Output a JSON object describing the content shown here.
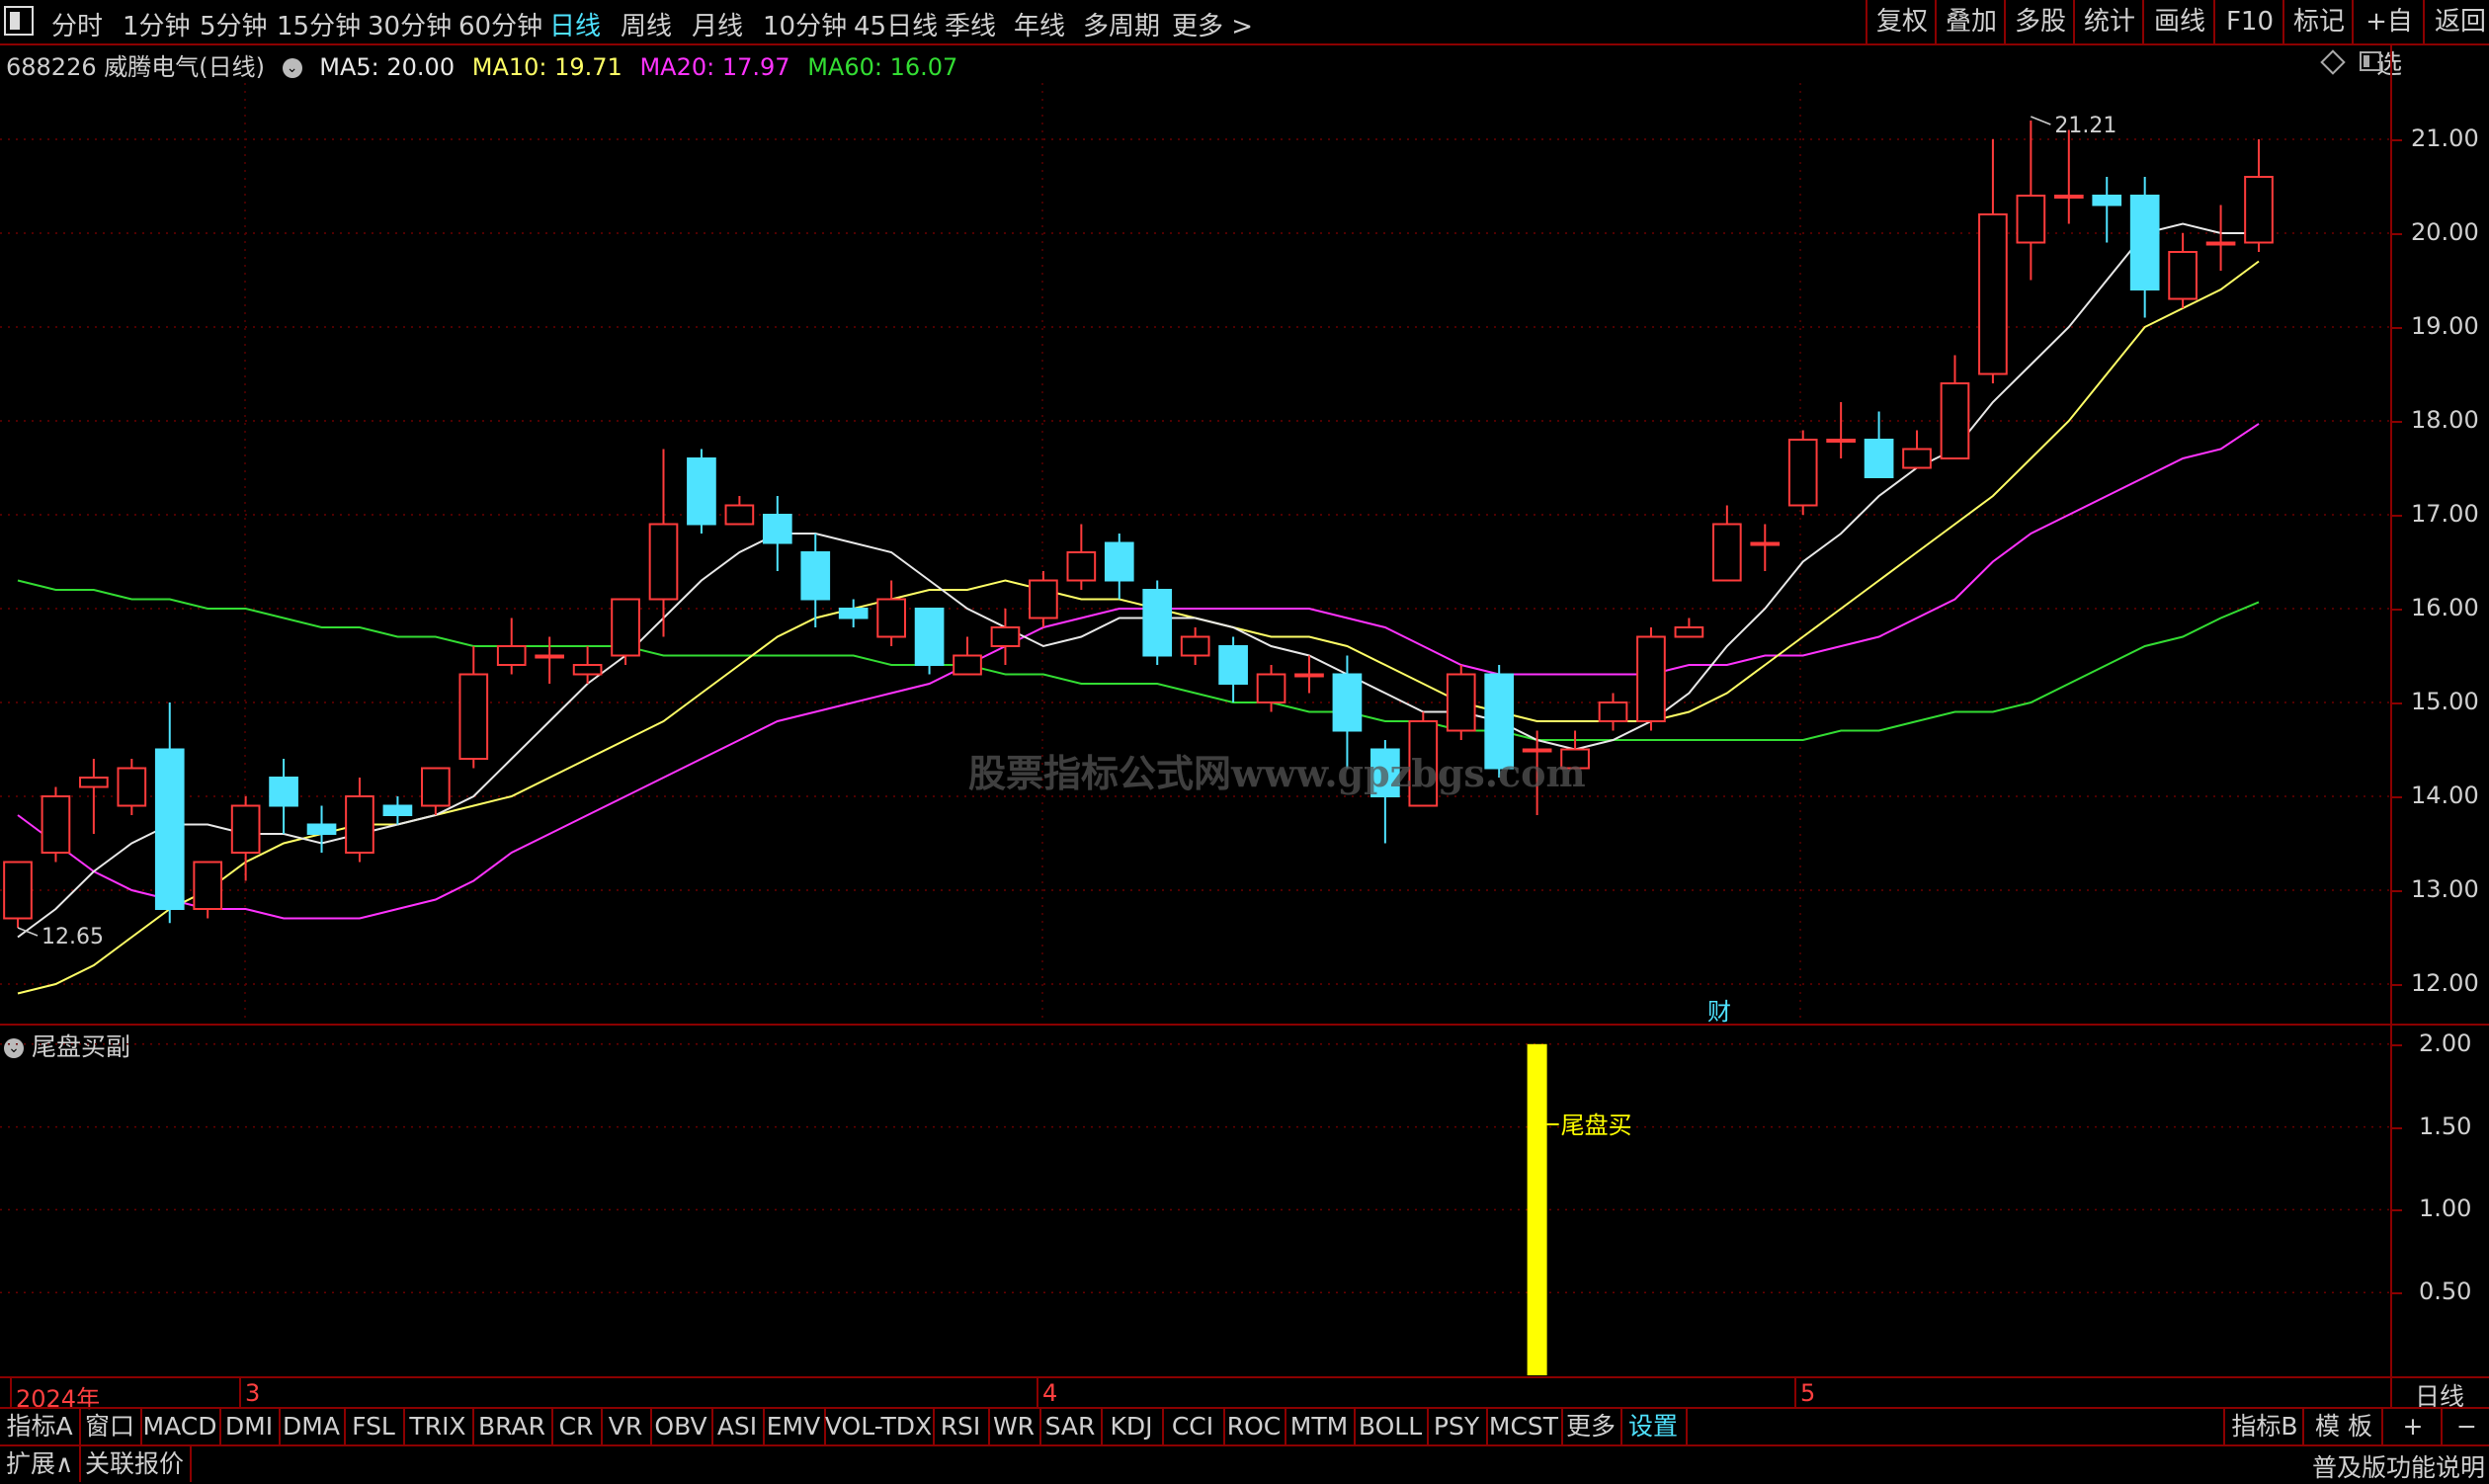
{
  "topbar": {
    "periods": [
      "分时",
      "1分钟",
      "5分钟",
      "15分钟",
      "30分钟",
      "60分钟",
      "日线",
      "周线",
      "月线",
      "10分钟",
      "45日线",
      "季线",
      "年线",
      "多周期",
      "更多 >"
    ],
    "active_period": "日线",
    "right_buttons": [
      "复权",
      "叠加",
      "多股",
      "统计",
      "画线",
      "F10",
      "标记",
      "+自选",
      "返回"
    ]
  },
  "info": {
    "stock": "688226 威腾电气(日线)",
    "ma5": "MA5: 20.00",
    "ma10": "MA10: 19.71",
    "ma20": "MA20: 17.97",
    "ma60": "MA60: 16.07"
  },
  "colors": {
    "up": "#ff3b3b",
    "down": "#4fe3ff",
    "ma5": "#e8e8e8",
    "ma10": "#ffff66",
    "ma20": "#ff33ff",
    "ma60": "#33dd33",
    "frame": "#8b0000",
    "signal": "#ffff00"
  },
  "main_axis": [
    "21.00",
    "20.00",
    "19.00",
    "18.00",
    "17.00",
    "16.00",
    "15.00",
    "14.00",
    "13.00",
    "12.00"
  ],
  "sub_axis": [
    "2.00",
    "1.50",
    "1.00",
    "0.50"
  ],
  "annotations": {
    "high": "21.21",
    "low": "12.65",
    "finance_marker": "财"
  },
  "watermark": "股票指标公式网www.gpzbgs.com",
  "sub_panel": {
    "title": "尾盘买副",
    "signal_label": "尾盘买"
  },
  "date_axis": {
    "labels": [
      "2024年",
      "3",
      "4",
      "5"
    ],
    "period_label": "日线"
  },
  "indicator_tabs": [
    "指标A",
    "窗口",
    "MACD",
    "DMI",
    "DMA",
    "FSL",
    "TRIX",
    "BRAR",
    "CR",
    "VR",
    "OBV",
    "ASI",
    "EMV",
    "VOL-TDX",
    "RSI",
    "WR",
    "SAR",
    "KDJ",
    "CCI",
    "ROC",
    "MTM",
    "BOLL",
    "PSY",
    "MCST",
    "更多",
    "设置"
  ],
  "indicator_right": [
    "指标B",
    "模 板",
    "+",
    "−"
  ],
  "bottom_tabs": [
    "扩展∧",
    "关联报价"
  ],
  "bottom_right": "普及版功能说明",
  "chart_data": {
    "type": "candlestick",
    "ylim": [
      11.6,
      21.6
    ],
    "candles": [
      [
        12.7,
        13.3,
        12.6,
        13.3
      ],
      [
        13.4,
        14.0,
        13.3,
        14.1
      ],
      [
        14.1,
        14.2,
        13.6,
        14.4
      ],
      [
        13.9,
        14.3,
        13.8,
        14.4
      ],
      [
        14.5,
        12.8,
        12.65,
        15.0
      ],
      [
        12.8,
        13.3,
        12.7,
        13.3
      ],
      [
        13.4,
        13.9,
        13.1,
        14.0
      ],
      [
        14.2,
        13.9,
        13.6,
        14.4
      ],
      [
        13.7,
        13.6,
        13.4,
        13.9
      ],
      [
        13.4,
        14.0,
        13.3,
        14.2
      ],
      [
        13.9,
        13.8,
        13.7,
        14.0
      ],
      [
        13.9,
        14.3,
        13.8,
        14.3
      ],
      [
        14.4,
        15.3,
        14.3,
        15.6
      ],
      [
        15.4,
        15.6,
        15.3,
        15.9
      ],
      [
        15.5,
        15.5,
        15.2,
        15.7
      ],
      [
        15.3,
        15.4,
        15.2,
        15.6
      ],
      [
        15.5,
        16.1,
        15.4,
        16.1
      ],
      [
        16.1,
        16.9,
        15.7,
        17.7
      ],
      [
        17.6,
        16.9,
        16.8,
        17.7
      ],
      [
        16.9,
        17.1,
        16.9,
        17.2
      ],
      [
        17.0,
        16.7,
        16.4,
        17.2
      ],
      [
        16.6,
        16.1,
        15.8,
        16.8
      ],
      [
        16.0,
        15.9,
        15.8,
        16.1
      ],
      [
        15.7,
        16.1,
        15.6,
        16.3
      ],
      [
        16.0,
        15.4,
        15.3,
        16.0
      ],
      [
        15.3,
        15.5,
        15.3,
        15.7
      ],
      [
        15.6,
        15.8,
        15.4,
        16.0
      ],
      [
        15.9,
        16.3,
        15.8,
        16.4
      ],
      [
        16.3,
        16.6,
        16.2,
        16.9
      ],
      [
        16.7,
        16.3,
        16.1,
        16.8
      ],
      [
        16.2,
        15.5,
        15.4,
        16.3
      ],
      [
        15.5,
        15.7,
        15.4,
        15.8
      ],
      [
        15.6,
        15.2,
        15.0,
        15.7
      ],
      [
        15.0,
        15.3,
        14.9,
        15.4
      ],
      [
        15.3,
        15.3,
        15.1,
        15.5
      ],
      [
        15.3,
        14.7,
        14.3,
        15.5
      ],
      [
        14.5,
        14.0,
        13.5,
        14.6
      ],
      [
        13.9,
        14.8,
        13.9,
        14.9
      ],
      [
        14.7,
        15.3,
        14.6,
        15.4
      ],
      [
        15.3,
        14.3,
        14.2,
        15.4
      ],
      [
        14.5,
        14.5,
        13.8,
        14.7
      ],
      [
        14.3,
        14.5,
        14.3,
        14.7
      ],
      [
        14.8,
        15.0,
        14.7,
        15.1
      ],
      [
        14.8,
        15.7,
        14.7,
        15.8
      ],
      [
        15.7,
        15.8,
        15.7,
        15.9
      ],
      [
        16.3,
        16.9,
        16.3,
        17.1
      ],
      [
        16.7,
        16.7,
        16.4,
        16.9
      ],
      [
        17.1,
        17.8,
        17.0,
        17.9
      ],
      [
        17.8,
        17.8,
        17.6,
        18.2
      ],
      [
        17.8,
        17.4,
        17.4,
        18.1
      ],
      [
        17.5,
        17.7,
        17.5,
        17.9
      ],
      [
        17.6,
        18.4,
        17.6,
        18.7
      ],
      [
        18.5,
        20.2,
        18.4,
        21.0
      ],
      [
        19.9,
        20.4,
        19.5,
        21.2
      ],
      [
        20.4,
        20.4,
        20.1,
        21.1
      ],
      [
        20.4,
        20.3,
        19.9,
        20.6
      ],
      [
        20.4,
        19.4,
        19.1,
        20.6
      ],
      [
        19.3,
        19.8,
        19.2,
        20.0
      ],
      [
        19.9,
        19.9,
        19.6,
        20.3
      ],
      [
        19.9,
        20.6,
        19.8,
        21.0
      ]
    ],
    "ma5": [
      12.5,
      12.8,
      13.2,
      13.5,
      13.7,
      13.7,
      13.6,
      13.6,
      13.5,
      13.6,
      13.7,
      13.8,
      14.0,
      14.4,
      14.8,
      15.2,
      15.5,
      15.9,
      16.3,
      16.6,
      16.8,
      16.8,
      16.7,
      16.6,
      16.3,
      16.0,
      15.8,
      15.6,
      15.7,
      15.9,
      15.9,
      15.9,
      15.8,
      15.6,
      15.5,
      15.3,
      15.1,
      14.9,
      14.9,
      14.8,
      14.6,
      14.5,
      14.6,
      14.8,
      15.1,
      15.6,
      16.0,
      16.5,
      16.8,
      17.2,
      17.5,
      17.7,
      18.2,
      18.6,
      19.0,
      19.5,
      20.0,
      20.1,
      20.0,
      20.0
    ],
    "ma10": [
      11.9,
      12.0,
      12.2,
      12.5,
      12.8,
      13.0,
      13.3,
      13.5,
      13.6,
      13.7,
      13.7,
      13.8,
      13.9,
      14.0,
      14.2,
      14.4,
      14.6,
      14.8,
      15.1,
      15.4,
      15.7,
      15.9,
      16.0,
      16.1,
      16.2,
      16.2,
      16.3,
      16.2,
      16.1,
      16.1,
      16.0,
      15.9,
      15.8,
      15.7,
      15.7,
      15.6,
      15.4,
      15.2,
      15.0,
      14.9,
      14.8,
      14.8,
      14.8,
      14.8,
      14.9,
      15.1,
      15.4,
      15.7,
      16.0,
      16.3,
      16.6,
      16.9,
      17.2,
      17.6,
      18.0,
      18.5,
      19.0,
      19.2,
      19.4,
      19.7
    ],
    "ma20": [
      13.8,
      13.5,
      13.2,
      13.0,
      12.9,
      12.8,
      12.8,
      12.7,
      12.7,
      12.7,
      12.8,
      12.9,
      13.1,
      13.4,
      13.6,
      13.8,
      14.0,
      14.2,
      14.4,
      14.6,
      14.8,
      14.9,
      15.0,
      15.1,
      15.2,
      15.4,
      15.6,
      15.8,
      15.9,
      16.0,
      16.0,
      16.0,
      16.0,
      16.0,
      16.0,
      15.9,
      15.8,
      15.6,
      15.4,
      15.3,
      15.3,
      15.3,
      15.3,
      15.3,
      15.4,
      15.4,
      15.5,
      15.5,
      15.6,
      15.7,
      15.9,
      16.1,
      16.5,
      16.8,
      17.0,
      17.2,
      17.4,
      17.6,
      17.7,
      17.97
    ],
    "ma60": [
      16.3,
      16.2,
      16.2,
      16.1,
      16.1,
      16.0,
      16.0,
      15.9,
      15.8,
      15.8,
      15.7,
      15.7,
      15.6,
      15.6,
      15.6,
      15.6,
      15.6,
      15.5,
      15.5,
      15.5,
      15.5,
      15.5,
      15.5,
      15.4,
      15.4,
      15.4,
      15.3,
      15.3,
      15.2,
      15.2,
      15.2,
      15.1,
      15.0,
      15.0,
      14.9,
      14.9,
      14.8,
      14.8,
      14.7,
      14.7,
      14.6,
      14.6,
      14.6,
      14.6,
      14.6,
      14.6,
      14.6,
      14.6,
      14.7,
      14.7,
      14.8,
      14.9,
      14.9,
      15.0,
      15.2,
      15.4,
      15.6,
      15.7,
      15.9,
      16.07
    ],
    "sub_ylim": [
      0,
      2.1
    ],
    "signal_index": 40,
    "signal_value": 2.0
  }
}
